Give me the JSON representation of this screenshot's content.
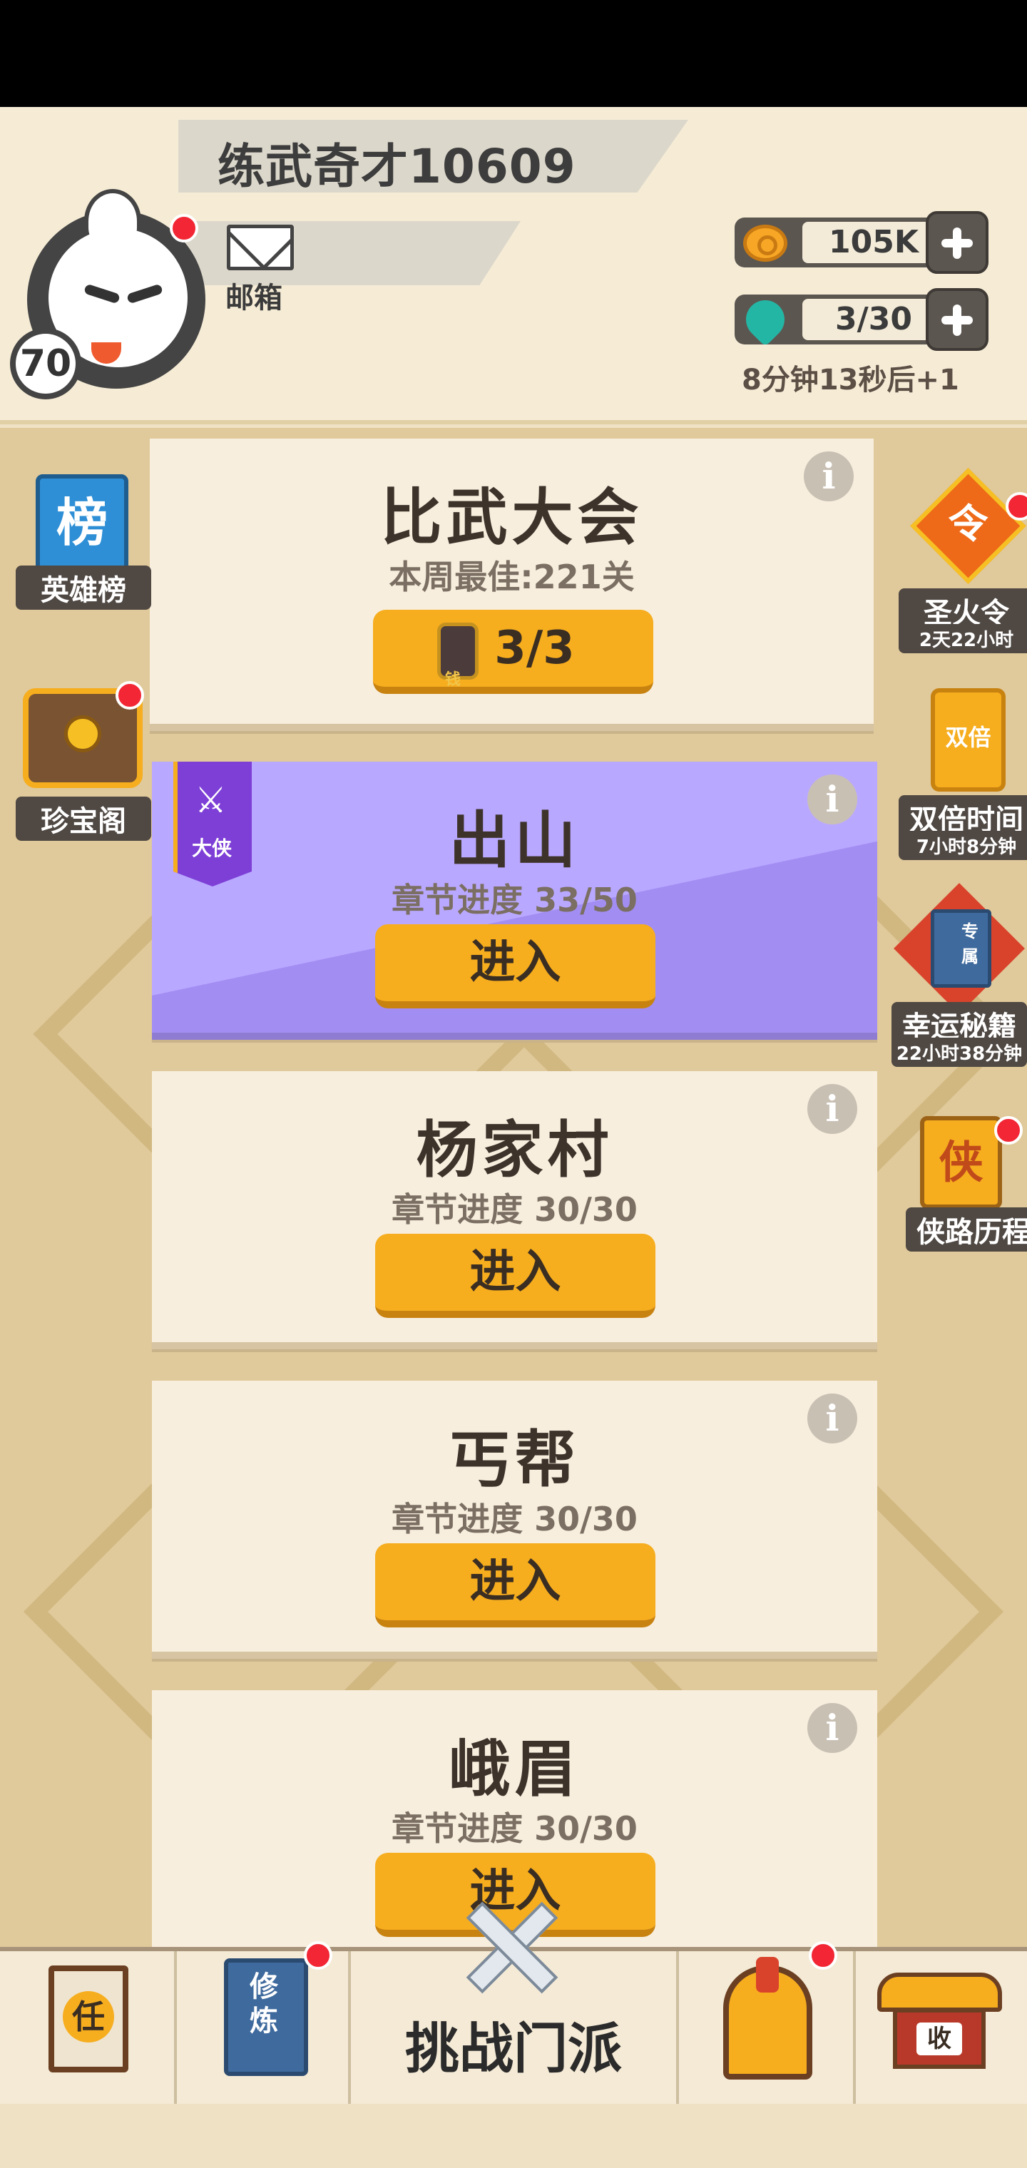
{
  "header": {
    "player_name": "练武奇才10609",
    "level": "70",
    "mail_label": "邮箱",
    "gold": "105K",
    "stamina": "3/30",
    "stamina_timer": "8分钟13秒后+1"
  },
  "left_sidebar": {
    "hero_rank": {
      "icon_text": "榜",
      "label": "英雄榜"
    },
    "treasure": {
      "label": "珍宝阁"
    }
  },
  "right_sidebar": {
    "holy_fire": {
      "icon_text": "令",
      "label": "圣火令",
      "timer": "2天22小时"
    },
    "double_time": {
      "icon_text": "双倍",
      "label": "双倍时间",
      "timer": "7小时8分钟"
    },
    "lucky_book": {
      "icon_text": "专属",
      "label": "幸运秘籍",
      "timer": "22小时38分钟"
    },
    "hero_journey": {
      "icon_text": "侠",
      "label": "侠路历程"
    }
  },
  "cards": [
    {
      "title": "比武大会",
      "subtitle": "本周最佳:221关",
      "button": "3/3",
      "ticket_text": "钱"
    },
    {
      "title": "出山",
      "subtitle": "章节进度 33/50",
      "button": "进入",
      "rank_label": "大侠"
    },
    {
      "title": "杨家村",
      "subtitle": "章节进度 30/30",
      "button": "进入"
    },
    {
      "title": "丐帮",
      "subtitle": "章节进度 30/30",
      "button": "进入"
    },
    {
      "title": "峨眉",
      "subtitle": "章节进度 30/30",
      "button": "进入"
    }
  ],
  "info_glyph": "i",
  "bottom_nav": {
    "task_icon_text": "任",
    "training_icon_text": "修炼",
    "center_label": "挑战门派",
    "shop_icon_text": "收"
  },
  "colors": {
    "accent_orange": "#f6ad1e",
    "badge_red": "#f22634",
    "purple_card": "#b9a8ff"
  }
}
